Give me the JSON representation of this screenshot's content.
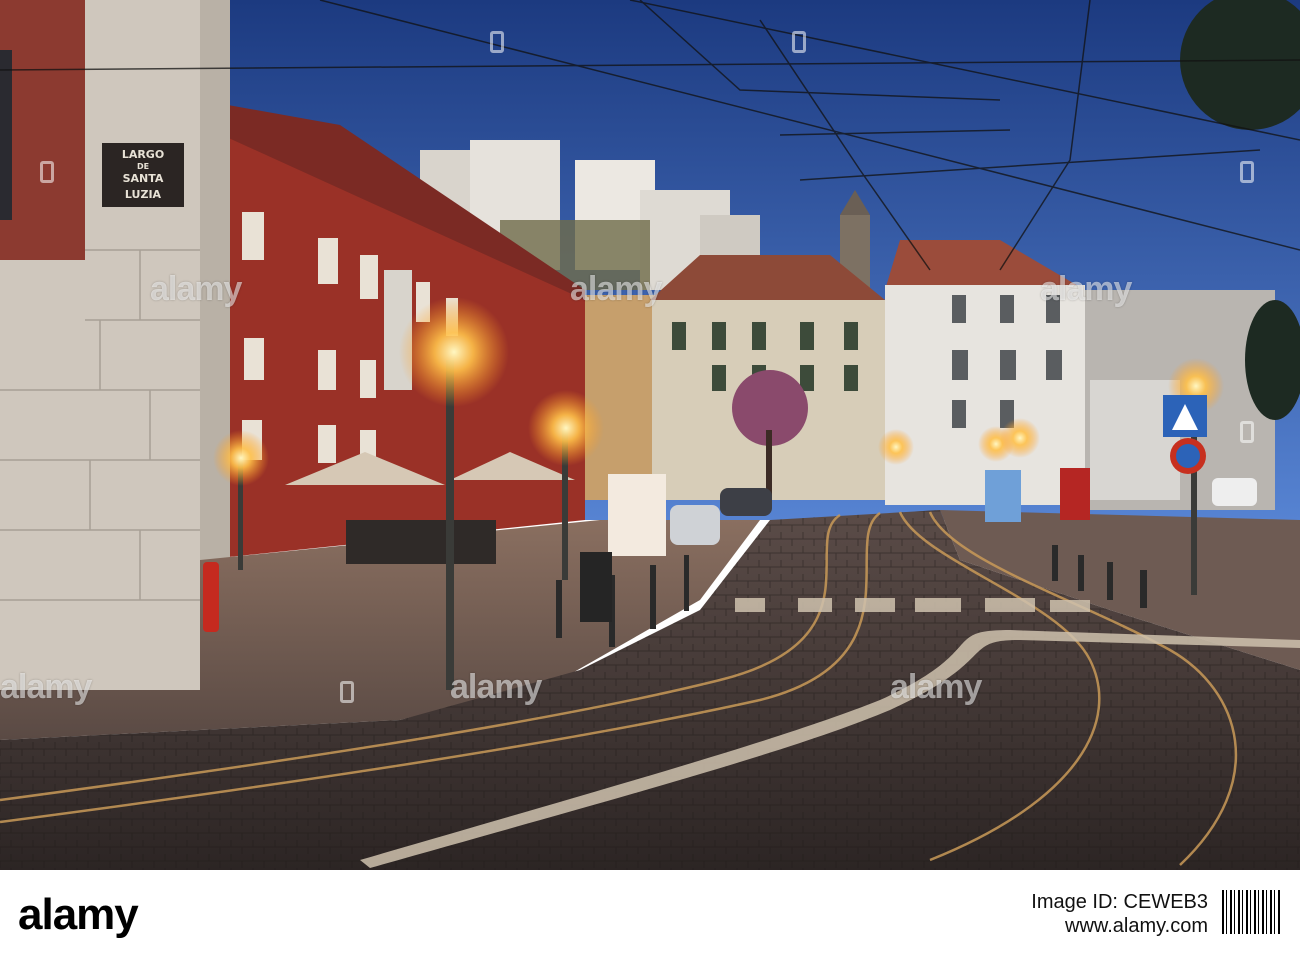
{
  "photo": {
    "street_sign_lines": [
      "LARGO",
      "DE",
      "SANTA",
      "LUZIA"
    ],
    "sign_colors": {
      "plate": "#2b2523",
      "text": "#e8e2d6"
    },
    "palette": {
      "sky_top": "#1f3f86",
      "sky_bottom": "#4a76c8",
      "red_building": "#9a3127",
      "cobblestone": "#3a3230",
      "lamp_glow": "#ffc14a"
    },
    "watermarks": [
      "alamy",
      "alamy",
      "alamy",
      "alamy",
      "alamy",
      "alamy"
    ]
  },
  "footer": {
    "logo": "alamy",
    "image_id_label": "Image ID: CEWEB3",
    "url": "www.alamy.com"
  }
}
